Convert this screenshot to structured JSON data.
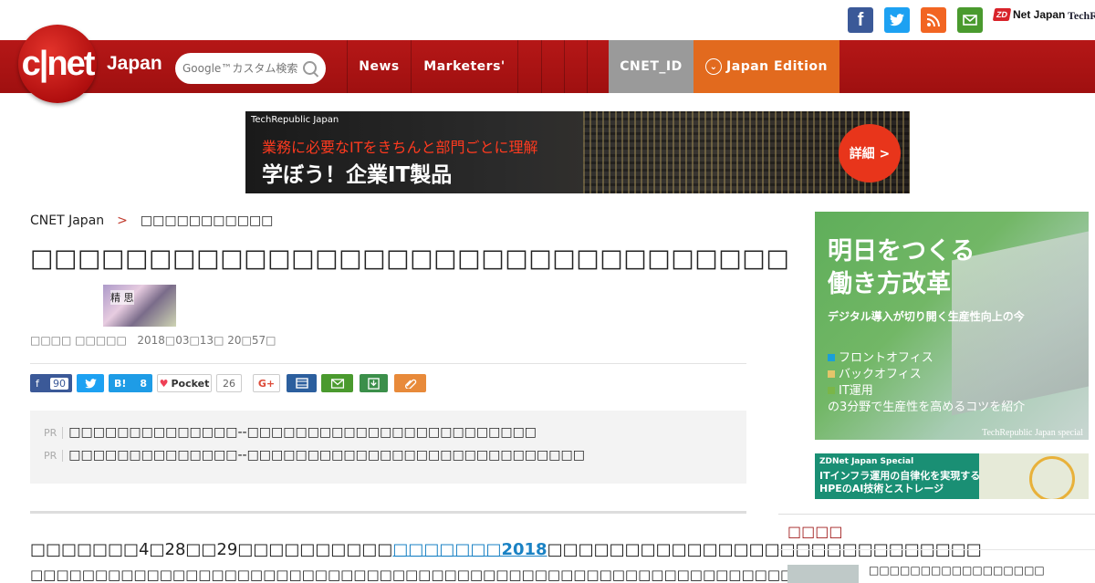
{
  "social": {
    "facebook_glyph": "f",
    "zdnet_badge": "ZD",
    "zdnet_name": "Net Japan",
    "techrepublic": "TechRe"
  },
  "nav": {
    "logo": "c|net",
    "logo_sub": "Japan",
    "search_placeholder": "Google™カスタム検索",
    "items": [
      "News",
      "Marketers'",
      "",
      "",
      "",
      ""
    ],
    "cnet_id": "CNET_ID",
    "edition": "Japan Edition",
    "colors": {
      "bar": "#b51717",
      "cnet_id_bg": "#9a9a9a",
      "edition_bg": "#e26a1e"
    }
  },
  "banner": {
    "label": "TechRepublic Japan",
    "line1": "業務に必要なITをきちんと部門ごとに理解",
    "line2": "学ぼう！企業IT製品",
    "button": "詳細 >"
  },
  "breadcrumb": {
    "home": "CNET Japan",
    "sep": ">",
    "current": "□□□□□□□□□□□"
  },
  "article": {
    "title": "□□□□□□□□□□□□□□□□□□□□□□□□□□□□□□□□",
    "thumb_text": "精  思",
    "byline_author": "□□□□ □□□□□",
    "byline_date": "2018□03□13□ 20□57□"
  },
  "share": {
    "facebook_count": "90",
    "hatena": "B!",
    "hatena_count": "8",
    "pocket": "Pocket",
    "pocket_count": "26",
    "google": "G+"
  },
  "pr": [
    {
      "tag": "PR",
      "text": "□□□□□□□□□□□□□□--□□□□□□□□□□□□□□□□□□□□□□□□"
    },
    {
      "tag": "PR",
      "text": "□□□□□□□□□□□□□□--□□□□□□□□□□□□□□□□□□□□□□□□□□□□"
    }
  ],
  "body": {
    "prefix": "□□□□□□□4□28□□29□□□□□□□□□□",
    "link": "□□□□□□□2018",
    "suffix": "□□□□□□□□□□□□□□□□□□□□□□□□□□□□",
    "line2": "□□□□□□□□□□□□□□□□□□□□□□□□□□□□□□□□□□□□□□□□□□□□□□□□□□□□□□□□□□□□"
  },
  "sidebar": {
    "ad1": {
      "headline1": "明日をつくる",
      "headline2": "働き方改革",
      "sub": "デジタル導入が切り開く生産性向上の今",
      "items": [
        "フロントオフィス",
        "バックオフィス",
        "IT運用"
      ],
      "item_colors": [
        "#1a9fd8",
        "#e3c56a",
        "#7ab648"
      ],
      "tail": "の3分野で生産性を高めるコツを紹介",
      "foot": "TechRepublic Japan special"
    },
    "ad2": {
      "label": "ZDNet Japan Special",
      "line1": "ITインフラ運用の自律化を実現する",
      "line2": "HPEのAI技術とストレージ"
    },
    "section_title": "□□□□",
    "item_text": "□□□□□□□□□□□□□□□□□"
  }
}
